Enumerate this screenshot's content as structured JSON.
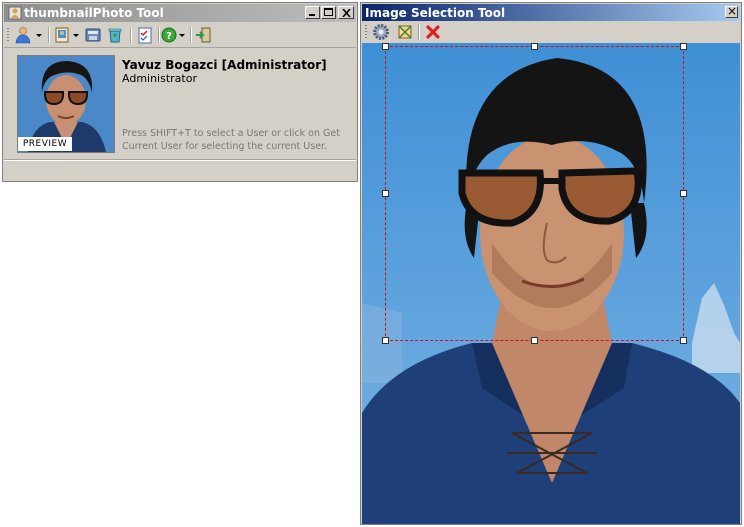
{
  "window_main": {
    "title": "thumbnailPhoto Tool",
    "toolbar": {
      "user_icon": "user-icon",
      "photo_icon": "photo-icon",
      "save_icon": "save-icon",
      "recycle_icon": "recycle-icon",
      "checklist_icon": "checklist-icon",
      "help_icon": "help-icon",
      "exit_icon": "exit-icon"
    },
    "preview_label": "PREVIEW",
    "user_name": "Yavuz Bogazci [Administrator]",
    "user_role": "Administrator",
    "hint": "Press SHIFT+T to select a User or click on Get Current User for selecting the current User."
  },
  "window_selection": {
    "title": "Image Selection Tool",
    "close_glyph": "×",
    "toolbar": {
      "settings_icon": "gear-icon",
      "crop_icon": "crop-icon",
      "cancel_icon": "close-icon"
    }
  },
  "colors": {
    "inactive_title": "#8f8f8f",
    "active_title": "#0a246a",
    "crop_border": "#d01010",
    "window_bg": "#d4d0c8"
  }
}
